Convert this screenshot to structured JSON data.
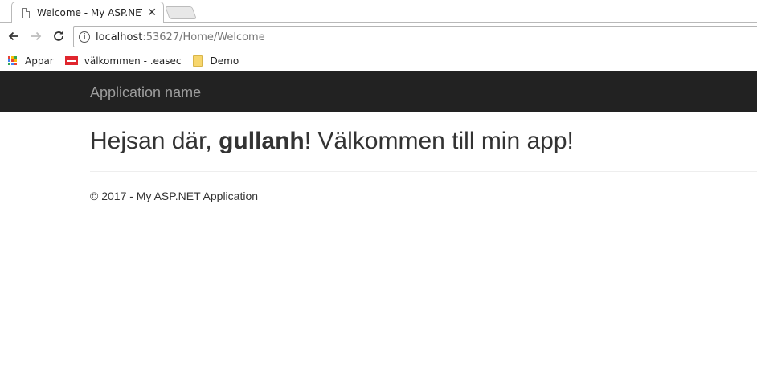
{
  "browser": {
    "tab": {
      "title": "Welcome - My ASP.NET Application",
      "close_glyph": "✕"
    },
    "url": {
      "host": "localhost",
      "rest": ":53627/Home/Welcome"
    },
    "bookmarks": [
      {
        "label": "Appar",
        "icon": "apps-grid-icon"
      },
      {
        "label": "välkommen - .easec",
        "icon": "flag-icon"
      },
      {
        "label": "Demo",
        "icon": "folder-icon"
      }
    ]
  },
  "app": {
    "brand": "Application name",
    "heading": {
      "prefix": "Hejsan där, ",
      "username": "gullanh",
      "suffix": "! Välkommen till min app!"
    },
    "footer": "© 2017 - My ASP.NET Application"
  },
  "colors": {
    "navbar_bg": "#222222",
    "brand_text": "#9d9d9d",
    "apps_grid": [
      "#e94335",
      "#fbbc05",
      "#34a853",
      "#4285f4",
      "#e94335",
      "#fbbc05",
      "#34a853",
      "#4285f4",
      "#e94335"
    ]
  }
}
